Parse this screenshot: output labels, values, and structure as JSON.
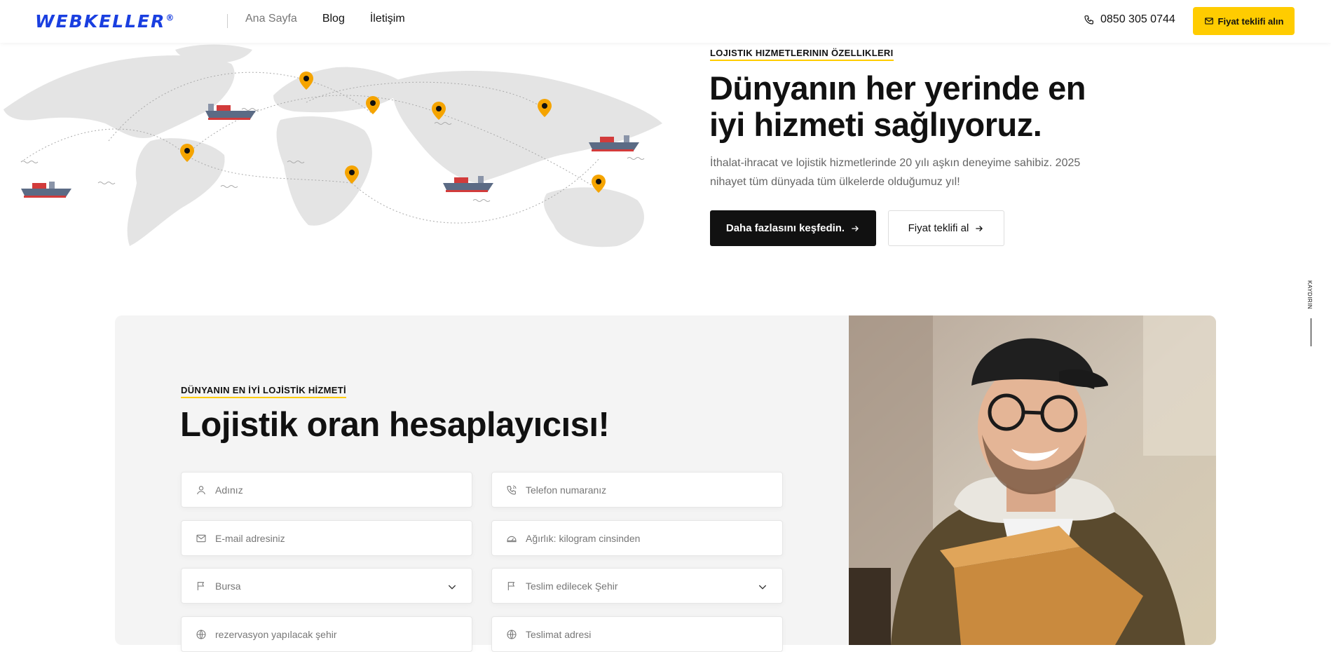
{
  "header": {
    "logo_text": "WEBKELLER",
    "logo_mark": "®",
    "nav": [
      "Ana Sayfa",
      "Blog",
      "İletişim"
    ],
    "phone": "0850 305 0744",
    "quote_button": "Fiyat teklifi alın",
    "phone_icon": "phone-icon",
    "mail_icon": "mail-icon"
  },
  "hero": {
    "eyebrow": "LOJISTIK HIZMETLERININ ÖZELLIKLERI",
    "title": "Dünyanın her yerinde en iyi hizmeti sağlıyoruz.",
    "text": "İthalat-ihracat ve lojistik hizmetlerinde 20 yılı aşkın deneyime sahibiz. 2025 nihayet tüm dünyada tüm ülkelerde olduğumuz yıl!",
    "primary_button": "Daha fazlasını keşfedin.",
    "secondary_button": "Fiyat teklifi al"
  },
  "scroll_label": "KAYDIRIN",
  "calculator": {
    "eyebrow": "DÜNYANIN EN İYİ LOJİSTİK HİZMETİ",
    "title": "Lojistik oran hesaplayıcısı!",
    "fields": {
      "name": "Adınız",
      "phone": "Telefon numaranız",
      "email": "E-mail adresiniz",
      "weight": "Ağırlık: kilogram cinsinden",
      "origin_city": "Bursa",
      "destination_city": "Teslim edilecek Şehir",
      "reservation_city": "rezervasyon yapılacak şehir",
      "delivery_address": "Teslimat adresi"
    }
  },
  "colors": {
    "accent": "#ffcc00",
    "brand_blue": "#1a3fe0",
    "dark": "#111111",
    "pin": "#f5a400"
  }
}
